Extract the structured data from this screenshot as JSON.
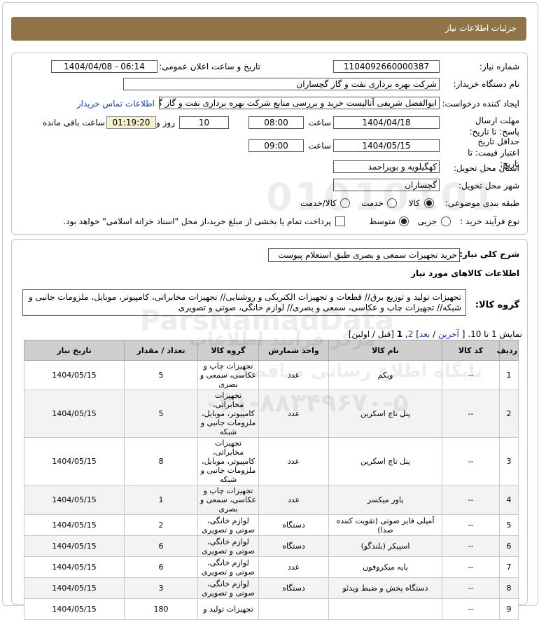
{
  "header": {
    "title": "جزئیات اطلاعات نیاز"
  },
  "details": {
    "need_number_label": "شماره نیاز:",
    "need_number": "1104092660000387",
    "announce_label": "تاریخ و ساعت اعلان عمومی:",
    "announce_value": "1404/04/08 - 06:14",
    "buyer_label": "نام دستگاه خریدار:",
    "buyer": "شرکت بهره برداری نفت و گاز گچساران",
    "creator_label": "ایجاد کننده درخواست:",
    "creator": "ابوالفضل شریفی آنالیست خرید و بررسی منابع شرکت بهره برداری نفت و گاز گچ",
    "contact_link": "اطلاعات تماس خریدار",
    "deadline_label": "مهلت ارسال پاسخ: تا تاریخ:",
    "deadline_date": "1404/04/18",
    "time_label": "ساعت",
    "deadline_time": "08:00",
    "days": "10",
    "days_label": "روز و",
    "remaining": "01:19:20",
    "remaining_label": "ساعت باقی مانده",
    "validity_label": "حداقل تاریخ اعتبار قیمت: تا تاریخ:",
    "validity_date": "1404/05/15",
    "validity_time": "09:00",
    "province_label": "استان محل تحویل:",
    "province": "کهگیلویه و بویراحمد",
    "city_label": "شهر محل تحویل:",
    "city": "گچساران",
    "category_label": "طبقه بندی موضوعی:",
    "category_options": [
      "کالا",
      "خدمت",
      "کالا/خدمت"
    ],
    "category_selected": "کالا",
    "purchase_type_label": "نوع فرآیند خرید :",
    "purchase_options": [
      "جزیی",
      "متوسط"
    ],
    "purchase_selected": "متوسط",
    "treasury_note": "پرداخت تمام یا بخشی از مبلغ خرید،از محل \"اسناد خزانه اسلامی\" خواهد بود."
  },
  "summary": {
    "desc_label": "شرح کلی نیاز:",
    "desc": "خرید تجهیزات سمعی و بصری طبق استعلام پیوست",
    "goods_info_title": "اطلاعات کالاهای مورد نیاز",
    "group_label": "گروه کالا:",
    "group_text": "تجهیزات تولید و توزیع برق// قطعات و تجهیزات الکتریکی و روشنایی// تجهیزات مخابراتی، کامپیوتر، موبایل، ملزومات جانبی و شبکه// تجهیزات چاپ و عکاسی، سمعی و بصری// لوازم خانگی، صوتی و تصویری"
  },
  "pagination": {
    "showing": "نمایش 1 تا 10.",
    "last": "آخرین",
    "next": "بعد",
    "page2": "2",
    "page1": "1",
    "prev_first": "[قبل / اولین]",
    "open_bracket": "[",
    "close_bracket": "]",
    "sep": "/",
    "comma": ","
  },
  "table": {
    "headers": [
      "ردیف",
      "کد کالا",
      "نام کالا",
      "واحد شمارش",
      "گروه کالا",
      "تعداد / مقدار",
      "تاریخ نیاز"
    ],
    "rows": [
      [
        "1",
        "--",
        "وبکم",
        "عدد",
        "تجهیزات چاپ و عکاسی، سمعی و بصری",
        "5",
        "1404/05/15"
      ],
      [
        "2",
        "--",
        "پنل تاچ اسکرین",
        "عدد",
        "تجهیزات مخابراتی، کامپیوتر، موبایل، ملزومات جانبی و شبکه",
        "5",
        "1404/05/15"
      ],
      [
        "3",
        "--",
        "پنل تاچ اسکرین",
        "عدد",
        "تجهیزات مخابراتی، کامپیوتر، موبایل، ملزومات جانبی و شبکه",
        "8",
        "1404/05/15"
      ],
      [
        "4",
        "--",
        "پاور میکسر",
        "عدد",
        "تجهیزات چاپ و عکاسی، سمعی و بصری",
        "1",
        "1404/05/15"
      ],
      [
        "5",
        "--",
        "آمپلی فایر صوتی (تقویت کننده صدا)",
        "دستگاه",
        "لوازم خانگی، صوتی و تصویری",
        "2",
        "1404/05/15"
      ],
      [
        "6",
        "--",
        "اسپیکر (بلندگو)",
        "دستگاه",
        "لوازم خانگی، صوتی و تصویری",
        "6",
        "1404/05/15"
      ],
      [
        "7",
        "--",
        "پایه میکروفون",
        "عدد",
        "لوازم خانگی، صوتی و تصویری",
        "6",
        "1404/05/15"
      ],
      [
        "8",
        "--",
        "دستگاه پخش و ضبط ویدئو",
        "دستگاه",
        "لوازم خانگی، صوتی و تصویری",
        "3",
        "1404/05/15"
      ],
      [
        "9",
        "--",
        "",
        "",
        "تجهیزات تولید و",
        "180",
        "1404/05/15"
      ]
    ]
  },
  "watermark": {
    "phone": "۰۲۱-۸۸۳۴۹۶۷۰-۵",
    "site": "ParsNamadData",
    "slogan": "پایگاه اطلاع رسانی مناقصات",
    "slogan2": "مرکز فرآیند اطلاعات",
    "digits": "01010101"
  }
}
